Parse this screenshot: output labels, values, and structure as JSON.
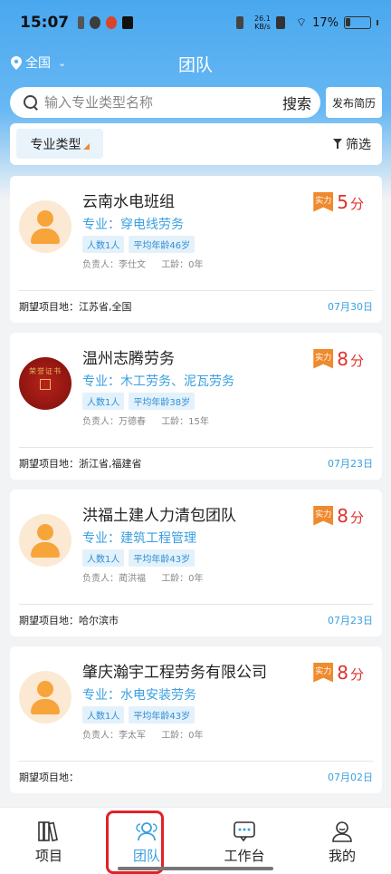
{
  "status_bar": {
    "time": "15:07",
    "net_speed_value": "26.1",
    "net_speed_unit": "KB/s",
    "battery": "17%"
  },
  "header": {
    "location": "全国",
    "title": "团队"
  },
  "search": {
    "placeholder": "输入专业类型名称",
    "button": "搜索",
    "publish": "发布简历"
  },
  "filter": {
    "type_label": "专业类型",
    "filter_label": "筛选"
  },
  "cards": [
    {
      "title": "云南水电班组",
      "specialty": "专业：穿电线劳务",
      "tag_people": "人数1人",
      "tag_age": "平均年龄46岁",
      "leader": "负责人：李仕文",
      "years": "工龄：0年",
      "badge": "实力",
      "score": "5",
      "score_unit": "分",
      "expect": "期望项目地：江苏省,全国",
      "date": "07月30日",
      "avatar": "person-icon"
    },
    {
      "title": "温州志腾劳务",
      "specialty": "专业：木工劳务、泥瓦劳务",
      "tag_people": "人数1人",
      "tag_age": "平均年龄38岁",
      "leader": "负责人：万德春",
      "years": "工龄：15年",
      "badge": "实力",
      "score": "8",
      "score_unit": "分",
      "expect": "期望项目地：浙江省,福建省",
      "date": "07月23日",
      "avatar": "certificate-photo",
      "avatar_text": "荣誉证书"
    },
    {
      "title": "洪福土建人力清包团队",
      "specialty": "专业：建筑工程管理",
      "tag_people": "人数1人",
      "tag_age": "平均年龄43岁",
      "leader": "负责人：蔺洪福",
      "years": "工龄：0年",
      "badge": "实力",
      "score": "8",
      "score_unit": "分",
      "expect": "期望项目地：哈尔滨市",
      "date": "07月23日",
      "avatar": "person-icon"
    },
    {
      "title": "肇庆瀚宇工程劳务有限公司",
      "specialty": "专业：水电安装劳务",
      "tag_people": "人数1人",
      "tag_age": "平均年龄43岁",
      "leader": "负责人：李太军",
      "years": "工龄：0年",
      "badge": "实力",
      "score": "8",
      "score_unit": "分",
      "expect": "期望项目地：",
      "date": "07月02日",
      "avatar": "person-icon"
    }
  ],
  "nav": {
    "items": [
      {
        "label": "项目",
        "icon": "books-icon"
      },
      {
        "label": "团队",
        "icon": "team-icon",
        "active": true
      },
      {
        "label": "工作台",
        "icon": "chat-icon"
      },
      {
        "label": "我的",
        "icon": "profile-icon"
      }
    ]
  },
  "colors": {
    "header": "#4aa8ef",
    "accent": "#3a9fe0",
    "score": "#e0322b",
    "badge": "#f08a2e",
    "highlight": "#e0222a"
  }
}
